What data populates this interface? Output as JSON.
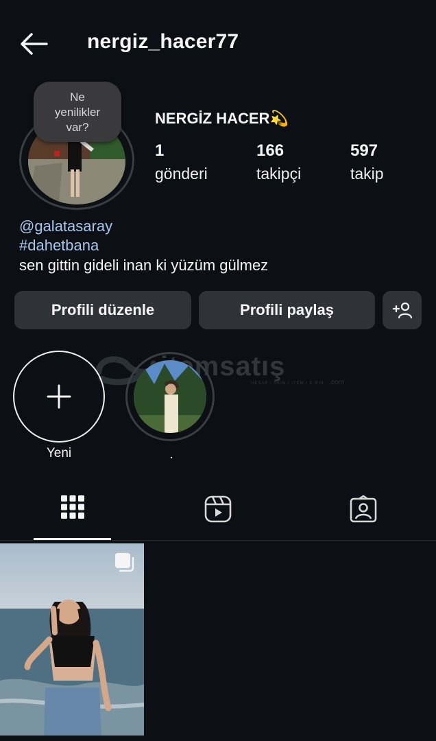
{
  "header": {
    "username": "nergiz_hacer77",
    "back_icon": "arrow-left-icon"
  },
  "profile": {
    "notes_bubble": {
      "line1": "Ne",
      "line2": "yenilikler",
      "line3": "var?"
    },
    "display_name": "NERGİZ HACER💫",
    "stats": [
      {
        "value": "1",
        "label": "gönderi"
      },
      {
        "value": "166",
        "label": "takipçi"
      },
      {
        "value": "597",
        "label": "takip"
      }
    ],
    "bio": {
      "threads_handle": "@galatasaray",
      "hashtag": "#dahetbana",
      "text": "sen gittin gideli inan ki yüzüm gülmez"
    }
  },
  "actions": {
    "edit_profile": "Profili düzenle",
    "share_profile": "Profili paylaş",
    "discover_icon": "add-person-icon"
  },
  "highlights": [
    {
      "label": "Yeni",
      "icon": "plus-icon"
    },
    {
      "label": "."
    }
  ],
  "tabs": [
    {
      "name": "posts",
      "icon": "grid-icon",
      "active": true
    },
    {
      "name": "reels",
      "icon": "reels-icon",
      "active": false
    },
    {
      "name": "tagged",
      "icon": "tagged-person-icon",
      "active": false
    }
  ],
  "watermark": {
    "brand": "itemsatış",
    "sub": "HESAP / SKIN / ITEM / E-PIN",
    "suffix": ".com"
  },
  "colors": {
    "background": "#0c1014",
    "button": "#2f3337",
    "link": "#a8c7ee"
  }
}
